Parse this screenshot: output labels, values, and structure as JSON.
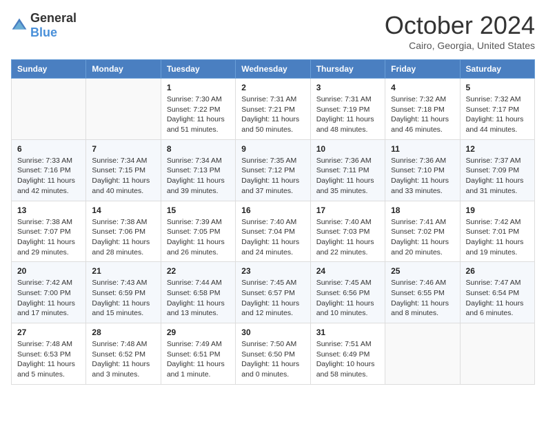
{
  "header": {
    "logo": {
      "general": "General",
      "blue": "Blue"
    },
    "title": "October 2024",
    "location": "Cairo, Georgia, United States"
  },
  "weekdays": [
    "Sunday",
    "Monday",
    "Tuesday",
    "Wednesday",
    "Thursday",
    "Friday",
    "Saturday"
  ],
  "weeks": [
    [
      {
        "day": "",
        "sunrise": "",
        "sunset": "",
        "daylight": ""
      },
      {
        "day": "",
        "sunrise": "",
        "sunset": "",
        "daylight": ""
      },
      {
        "day": "1",
        "sunrise": "Sunrise: 7:30 AM",
        "sunset": "Sunset: 7:22 PM",
        "daylight": "Daylight: 11 hours and 51 minutes."
      },
      {
        "day": "2",
        "sunrise": "Sunrise: 7:31 AM",
        "sunset": "Sunset: 7:21 PM",
        "daylight": "Daylight: 11 hours and 50 minutes."
      },
      {
        "day": "3",
        "sunrise": "Sunrise: 7:31 AM",
        "sunset": "Sunset: 7:19 PM",
        "daylight": "Daylight: 11 hours and 48 minutes."
      },
      {
        "day": "4",
        "sunrise": "Sunrise: 7:32 AM",
        "sunset": "Sunset: 7:18 PM",
        "daylight": "Daylight: 11 hours and 46 minutes."
      },
      {
        "day": "5",
        "sunrise": "Sunrise: 7:32 AM",
        "sunset": "Sunset: 7:17 PM",
        "daylight": "Daylight: 11 hours and 44 minutes."
      }
    ],
    [
      {
        "day": "6",
        "sunrise": "Sunrise: 7:33 AM",
        "sunset": "Sunset: 7:16 PM",
        "daylight": "Daylight: 11 hours and 42 minutes."
      },
      {
        "day": "7",
        "sunrise": "Sunrise: 7:34 AM",
        "sunset": "Sunset: 7:15 PM",
        "daylight": "Daylight: 11 hours and 40 minutes."
      },
      {
        "day": "8",
        "sunrise": "Sunrise: 7:34 AM",
        "sunset": "Sunset: 7:13 PM",
        "daylight": "Daylight: 11 hours and 39 minutes."
      },
      {
        "day": "9",
        "sunrise": "Sunrise: 7:35 AM",
        "sunset": "Sunset: 7:12 PM",
        "daylight": "Daylight: 11 hours and 37 minutes."
      },
      {
        "day": "10",
        "sunrise": "Sunrise: 7:36 AM",
        "sunset": "Sunset: 7:11 PM",
        "daylight": "Daylight: 11 hours and 35 minutes."
      },
      {
        "day": "11",
        "sunrise": "Sunrise: 7:36 AM",
        "sunset": "Sunset: 7:10 PM",
        "daylight": "Daylight: 11 hours and 33 minutes."
      },
      {
        "day": "12",
        "sunrise": "Sunrise: 7:37 AM",
        "sunset": "Sunset: 7:09 PM",
        "daylight": "Daylight: 11 hours and 31 minutes."
      }
    ],
    [
      {
        "day": "13",
        "sunrise": "Sunrise: 7:38 AM",
        "sunset": "Sunset: 7:07 PM",
        "daylight": "Daylight: 11 hours and 29 minutes."
      },
      {
        "day": "14",
        "sunrise": "Sunrise: 7:38 AM",
        "sunset": "Sunset: 7:06 PM",
        "daylight": "Daylight: 11 hours and 28 minutes."
      },
      {
        "day": "15",
        "sunrise": "Sunrise: 7:39 AM",
        "sunset": "Sunset: 7:05 PM",
        "daylight": "Daylight: 11 hours and 26 minutes."
      },
      {
        "day": "16",
        "sunrise": "Sunrise: 7:40 AM",
        "sunset": "Sunset: 7:04 PM",
        "daylight": "Daylight: 11 hours and 24 minutes."
      },
      {
        "day": "17",
        "sunrise": "Sunrise: 7:40 AM",
        "sunset": "Sunset: 7:03 PM",
        "daylight": "Daylight: 11 hours and 22 minutes."
      },
      {
        "day": "18",
        "sunrise": "Sunrise: 7:41 AM",
        "sunset": "Sunset: 7:02 PM",
        "daylight": "Daylight: 11 hours and 20 minutes."
      },
      {
        "day": "19",
        "sunrise": "Sunrise: 7:42 AM",
        "sunset": "Sunset: 7:01 PM",
        "daylight": "Daylight: 11 hours and 19 minutes."
      }
    ],
    [
      {
        "day": "20",
        "sunrise": "Sunrise: 7:42 AM",
        "sunset": "Sunset: 7:00 PM",
        "daylight": "Daylight: 11 hours and 17 minutes."
      },
      {
        "day": "21",
        "sunrise": "Sunrise: 7:43 AM",
        "sunset": "Sunset: 6:59 PM",
        "daylight": "Daylight: 11 hours and 15 minutes."
      },
      {
        "day": "22",
        "sunrise": "Sunrise: 7:44 AM",
        "sunset": "Sunset: 6:58 PM",
        "daylight": "Daylight: 11 hours and 13 minutes."
      },
      {
        "day": "23",
        "sunrise": "Sunrise: 7:45 AM",
        "sunset": "Sunset: 6:57 PM",
        "daylight": "Daylight: 11 hours and 12 minutes."
      },
      {
        "day": "24",
        "sunrise": "Sunrise: 7:45 AM",
        "sunset": "Sunset: 6:56 PM",
        "daylight": "Daylight: 11 hours and 10 minutes."
      },
      {
        "day": "25",
        "sunrise": "Sunrise: 7:46 AM",
        "sunset": "Sunset: 6:55 PM",
        "daylight": "Daylight: 11 hours and 8 minutes."
      },
      {
        "day": "26",
        "sunrise": "Sunrise: 7:47 AM",
        "sunset": "Sunset: 6:54 PM",
        "daylight": "Daylight: 11 hours and 6 minutes."
      }
    ],
    [
      {
        "day": "27",
        "sunrise": "Sunrise: 7:48 AM",
        "sunset": "Sunset: 6:53 PM",
        "daylight": "Daylight: 11 hours and 5 minutes."
      },
      {
        "day": "28",
        "sunrise": "Sunrise: 7:48 AM",
        "sunset": "Sunset: 6:52 PM",
        "daylight": "Daylight: 11 hours and 3 minutes."
      },
      {
        "day": "29",
        "sunrise": "Sunrise: 7:49 AM",
        "sunset": "Sunset: 6:51 PM",
        "daylight": "Daylight: 11 hours and 1 minute."
      },
      {
        "day": "30",
        "sunrise": "Sunrise: 7:50 AM",
        "sunset": "Sunset: 6:50 PM",
        "daylight": "Daylight: 11 hours and 0 minutes."
      },
      {
        "day": "31",
        "sunrise": "Sunrise: 7:51 AM",
        "sunset": "Sunset: 6:49 PM",
        "daylight": "Daylight: 10 hours and 58 minutes."
      },
      {
        "day": "",
        "sunrise": "",
        "sunset": "",
        "daylight": ""
      },
      {
        "day": "",
        "sunrise": "",
        "sunset": "",
        "daylight": ""
      }
    ]
  ]
}
